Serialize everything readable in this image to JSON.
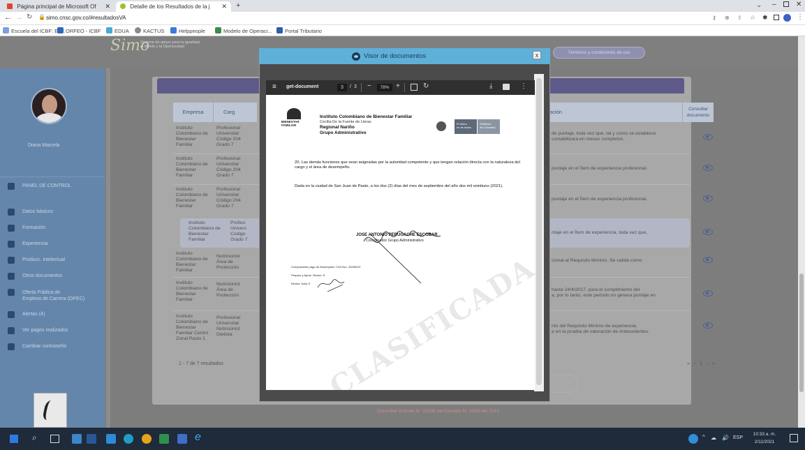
{
  "browser": {
    "tabs": [
      {
        "label": "Página principal de Microsoft Of"
      },
      {
        "label": "Detalle de los Resultados de la j"
      }
    ],
    "new_tab": "+",
    "url": "simo.cnsc.gov.co/#resultadosVA",
    "bookmarks": [
      {
        "label": "Escuela del ICBF: En..."
      },
      {
        "label": "ORFEO - ICBF"
      },
      {
        "label": "EDUA"
      },
      {
        "label": "KACTUS"
      },
      {
        "label": "Helppeople"
      },
      {
        "label": "Modelo de Operaci..."
      },
      {
        "label": "Portal Tributario"
      }
    ]
  },
  "app": {
    "brand_mark": "Simo",
    "brand_line1": "Sistema de apoyo para la igualdad,",
    "brand_line2": "el Mérito y la Oportunidad",
    "terms_button": "Términos y condiciones de uso",
    "user_name": "Diana Marcela",
    "sidebar": [
      {
        "label": "PANEL DE CONTROL"
      },
      {
        "label": "Datos básicos"
      },
      {
        "label": "Formación"
      },
      {
        "label": "Experiencia"
      },
      {
        "label": "Producc. intelectual"
      },
      {
        "label": "Otros documentos"
      },
      {
        "label": "Oferta Pública de\nEmpleos de Carrera (OPEC)"
      },
      {
        "label": "Alertas (4)"
      },
      {
        "label": "Ver pagos realizados"
      },
      {
        "label": "Cambiar contraseña"
      }
    ],
    "table": {
      "headers": [
        "Empresa",
        "Carg",
        "ación",
        "Consultar\ndocumento"
      ],
      "rows": [
        {
          "empresa": "Instituto\nColombiano de\nBienestar\nFamiliar",
          "cargo": "Profesional\nUniversitar\nCódigo 204\nGrado 7",
          "obs": "de puntaje, toda vez que, tal y como se establece\ncontabilizara en meses completos."
        },
        {
          "empresa": "Instituto\nColombiano de\nBienestar\nFamiliar",
          "cargo": "Profesional\nUniversitar\nCódigo 204\nGrado 7",
          "obs": "puntaje en el Ítem de experiencia profesional."
        },
        {
          "empresa": "Instituto\nColombiano de\nBienestar\nFamiliar",
          "cargo": "Profesional\nUniversitar\nCódigo 204\nGrado 7",
          "obs": "puntaje en el Ítem de experiencia profesional."
        },
        {
          "empresa": "Instituto\nColombiano de\nBienestar\nFamiliar",
          "cargo": "Profesi\nUnivers\nCódigo\nGrado 7",
          "obs": "ntaje en el Ítem de experiencia, toda vez que,"
        },
        {
          "empresa": "Instituto\nColombiano de\nBienestar\nFamiliar",
          "cargo": "Nutricionist\nÁrea de\nProtección",
          "obs": "cional al Requisito Mínimo. Se valida como"
        },
        {
          "empresa": "Instituto\nColombiano de\nBienestar\nFamiliar",
          "cargo": "Nutricionist\nÁrea de\nProtección",
          "obs": "hasta 24/4/2017, para el cumplimiento del\na, por lo tanto, este periodo no genera puntaje en"
        },
        {
          "empresa": "Instituto\nColombiano de\nBienestar\nFamiliar Centro\nZonal Pasto 1",
          "cargo": "Profesional\nUniversitar\nNutricionist\nDietista",
          "obs": "nto del Requisito Mínimo de experiencia.\ne en la prueba de valoración de Antecedentes."
        }
      ],
      "result_count": "1 - 7 de 7 resultados",
      "pager": "« ‹ 1 › »"
    },
    "footer_link": "Consultar Artículo N° 22336 del Decreto N° 1083 del 2015"
  },
  "modal": {
    "title": "Visor de documentos",
    "close": "x",
    "pdf": {
      "filename": "get-document",
      "page_current": "3",
      "page_sep": "/",
      "page_total": "3",
      "zoom": "78%",
      "org_name": "Instituto Colombiano de Bienestar Familiar",
      "org_sub": "Cecilia De la Fuente de Lleras",
      "org_region": "Regional Nariño",
      "org_group": "Grupo Administrativo",
      "logo_left": "BIENESTAR\nFAMILIAR",
      "logo_right1": "El futuro\nes de todos",
      "logo_right2": "Gobierno\nde Colombia",
      "para1": "20. Las demás funciones que sean asignadas por la autoridad competente y que tengan relación directa con la naturaleza del cargo y el área de desempeño.",
      "para2": "Dada en la ciudad de San Juan de Pasto, a los dos (2) días del mes de septiembre del año dos mil veintiuno (2021).",
      "signer": "JOSE ANTONIO PERUGACHE ESCOBAR",
      "signer_title": "Coordinador Grupo Administrativo",
      "note1": "Comprobante pago de Desempeño 7119 Nro. 20265237",
      "note2": "Preparo y Aprob. Reviso: E.",
      "note3": "Revisó: Kelly G.",
      "watermark": "CLASIFICADA"
    }
  },
  "taskbar": {
    "lang": "ESP",
    "time": "10:33 a. m.",
    "date": "2/11/2021"
  }
}
